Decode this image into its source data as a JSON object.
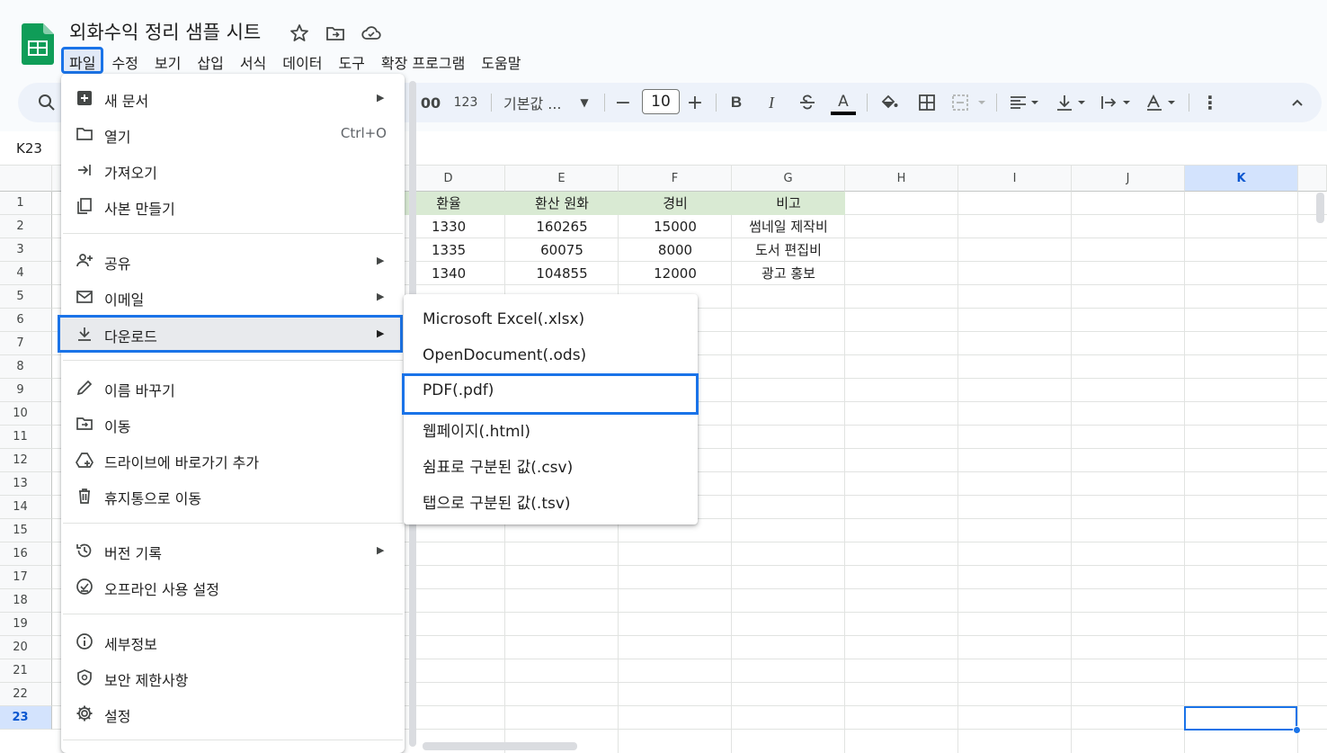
{
  "header": {
    "doc_title": "외화수익 정리 샘플 시트",
    "menu": [
      "파일",
      "수정",
      "보기",
      "삽입",
      "서식",
      "데이터",
      "도구",
      "확장 프로그램",
      "도움말"
    ],
    "active_menu_index": 0
  },
  "toolbar": {
    "decimal_label": "00",
    "format_123": "123",
    "font_family": "기본값 ...",
    "font_size": "10",
    "minus": "−",
    "plus": "+",
    "bold": "B",
    "italic": "I",
    "text_color_letter": "A",
    "highlight_letter": "A",
    "more": "⋮",
    "collapse": "^"
  },
  "formula_bar": {
    "name_box": "K23"
  },
  "sheet": {
    "columns": [
      "D",
      "E",
      "F",
      "G",
      "H",
      "I",
      "J",
      "K"
    ],
    "selected_column": "K",
    "rows": [
      "1",
      "2",
      "3",
      "4",
      "5",
      "6",
      "7",
      "8",
      "9",
      "10",
      "11",
      "12",
      "13",
      "14",
      "15",
      "16",
      "17",
      "18",
      "19",
      "20",
      "21",
      "22",
      "23"
    ],
    "selected_row": "23",
    "table_header": [
      "환율",
      "환산 원화",
      "경비",
      "비고"
    ],
    "table_rows": [
      [
        "1330",
        "160265",
        "15000",
        "썸네일 제작비"
      ],
      [
        "1335",
        "60075",
        "8000",
        "도서 편집비"
      ],
      [
        "1340",
        "104855",
        "12000",
        "광고 홍보"
      ]
    ]
  },
  "file_menu": {
    "items": [
      {
        "label": "새 문서",
        "icon": "new-doc-icon",
        "submenu": true
      },
      {
        "label": "열기",
        "icon": "folder-icon",
        "shortcut": "Ctrl+O"
      },
      {
        "label": "가져오기",
        "icon": "import-icon"
      },
      {
        "label": "사본 만들기",
        "icon": "copy-icon"
      },
      {
        "label": "공유",
        "icon": "share-person-icon",
        "submenu": true
      },
      {
        "label": "이메일",
        "icon": "mail-icon",
        "submenu": true
      },
      {
        "label": "다운로드",
        "icon": "download-icon",
        "submenu": true
      },
      {
        "label": "이름 바꾸기",
        "icon": "pencil-icon"
      },
      {
        "label": "이동",
        "icon": "move-folder-icon"
      },
      {
        "label": "드라이브에 바로가기 추가",
        "icon": "drive-shortcut-icon"
      },
      {
        "label": "휴지통으로 이동",
        "icon": "trash-icon"
      },
      {
        "label": "버전 기록",
        "icon": "history-icon",
        "submenu": true
      },
      {
        "label": "오프라인 사용 설정",
        "icon": "offline-icon"
      },
      {
        "label": "세부정보",
        "icon": "info-icon"
      },
      {
        "label": "보안 제한사항",
        "icon": "shield-icon"
      },
      {
        "label": "설정",
        "icon": "gear-icon"
      }
    ]
  },
  "download_submenu": {
    "items": [
      "Microsoft Excel(.xlsx)",
      "OpenDocument(.ods)",
      "PDF(.pdf)",
      "웹페이지(.html)",
      "쉼표로 구분된 값(.csv)",
      "탭으로 구분된 값(.tsv)"
    ],
    "highlighted_index": 2
  },
  "colors": {
    "accent": "#1a73e8",
    "header_fill": "#d9ead3",
    "sheets_green": "#0f9d58"
  }
}
